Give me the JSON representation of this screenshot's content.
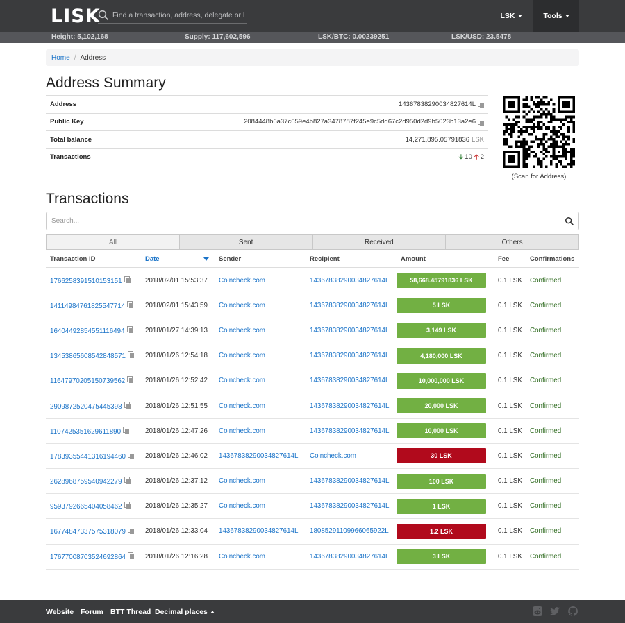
{
  "header": {
    "logo": "LISK",
    "search_placeholder": "Find a transaction, address, delegate or block",
    "currency_menu": "LSK",
    "tools_menu": "Tools"
  },
  "stats": {
    "height": "Height: 5,102,168",
    "supply": "Supply: 117,602,596",
    "lsk_btc": "LSK/BTC: 0.00239251",
    "lsk_usd": "LSK/USD: 23.5478"
  },
  "breadcrumb": {
    "home": "Home",
    "current": "Address"
  },
  "summary": {
    "title": "Address Summary",
    "rows": {
      "address": {
        "label": "Address",
        "value": "14367838290034827614L"
      },
      "public_key": {
        "label": "Public Key",
        "value": "2084448b6a37c659e4b827a3478787f245e9c5dd67c2d950d2d9b5023b13a2e6"
      },
      "balance": {
        "label": "Total balance",
        "value": "14,271,895.05791836",
        "unit": "LSK"
      },
      "transactions": {
        "label": "Transactions",
        "received": "10",
        "sent": "2"
      }
    },
    "qr_caption": "(Scan for Address)"
  },
  "transactions": {
    "title": "Transactions",
    "search_placeholder": "Search...",
    "filters": [
      "All",
      "Sent",
      "Received",
      "Others"
    ],
    "columns": {
      "id": "Transaction ID",
      "date": "Date",
      "sender": "Sender",
      "recipient": "Recipient",
      "amount": "Amount",
      "fee": "Fee",
      "confirmations": "Confirmations"
    },
    "rows": [
      {
        "id": "1766258391510153151",
        "date": "2018/02/01 15:53:37",
        "sender": "Coincheck.com",
        "recipient": "14367838290034827614L",
        "amount": "58,668.45791836 LSK",
        "dir": "in",
        "fee": "0.1 LSK",
        "status": "Confirmed"
      },
      {
        "id": "14114984761825547714",
        "date": "2018/02/01 15:43:59",
        "sender": "Coincheck.com",
        "recipient": "14367838290034827614L",
        "amount": "5 LSK",
        "dir": "in",
        "fee": "0.1 LSK",
        "status": "Confirmed"
      },
      {
        "id": "16404492854551116494",
        "date": "2018/01/27 14:39:13",
        "sender": "Coincheck.com",
        "recipient": "14367838290034827614L",
        "amount": "3,149 LSK",
        "dir": "in",
        "fee": "0.1 LSK",
        "status": "Confirmed"
      },
      {
        "id": "13453865608542848571",
        "date": "2018/01/26 12:54:18",
        "sender": "Coincheck.com",
        "recipient": "14367838290034827614L",
        "amount": "4,180,000 LSK",
        "dir": "in",
        "fee": "0.1 LSK",
        "status": "Confirmed"
      },
      {
        "id": "11647970205150739562",
        "date": "2018/01/26 12:52:42",
        "sender": "Coincheck.com",
        "recipient": "14367838290034827614L",
        "amount": "10,000,000 LSK",
        "dir": "in",
        "fee": "0.1 LSK",
        "status": "Confirmed"
      },
      {
        "id": "2909872520475445398",
        "date": "2018/01/26 12:51:55",
        "sender": "Coincheck.com",
        "recipient": "14367838290034827614L",
        "amount": "20,000 LSK",
        "dir": "in",
        "fee": "0.1 LSK",
        "status": "Confirmed"
      },
      {
        "id": "1107425351629611890",
        "date": "2018/01/26 12:47:26",
        "sender": "Coincheck.com",
        "recipient": "14367838290034827614L",
        "amount": "10,000 LSK",
        "dir": "in",
        "fee": "0.1 LSK",
        "status": "Confirmed"
      },
      {
        "id": "17839355441316194460",
        "date": "2018/01/26 12:46:02",
        "sender": "14367838290034827614L",
        "recipient": "Coincheck.com",
        "amount": "30 LSK",
        "dir": "out",
        "fee": "0.1 LSK",
        "status": "Confirmed"
      },
      {
        "id": "2628968759540942279",
        "date": "2018/01/26 12:37:12",
        "sender": "Coincheck.com",
        "recipient": "14367838290034827614L",
        "amount": "100 LSK",
        "dir": "in",
        "fee": "0.1 LSK",
        "status": "Confirmed"
      },
      {
        "id": "9593792665404058462",
        "date": "2018/01/26 12:35:27",
        "sender": "Coincheck.com",
        "recipient": "14367838290034827614L",
        "amount": "1 LSK",
        "dir": "in",
        "fee": "0.1 LSK",
        "status": "Confirmed"
      },
      {
        "id": "16774847337575318079",
        "date": "2018/01/26 12:33:04",
        "sender": "14367838290034827614L",
        "recipient": "18085291109966065922L",
        "amount": "1.2 LSK",
        "dir": "out",
        "fee": "0.1 LSK",
        "status": "Confirmed"
      },
      {
        "id": "17677008703524692864",
        "date": "2018/01/26 12:16:28",
        "sender": "Coincheck.com",
        "recipient": "14367838290034827614L",
        "amount": "3 LSK",
        "dir": "in",
        "fee": "0.1 LSK",
        "status": "Confirmed"
      }
    ]
  },
  "footer": {
    "links": [
      "Website",
      "Forum",
      "BTT Thread"
    ],
    "decimal_menu": "Decimal places",
    "icons": [
      "github-icon",
      "twitter-icon",
      "reddit-icon"
    ]
  },
  "colors": {
    "navbar": "#3a3b3d",
    "incoming": "#72b043",
    "outgoing": "#b10a1c",
    "link": "#1a73c8"
  }
}
